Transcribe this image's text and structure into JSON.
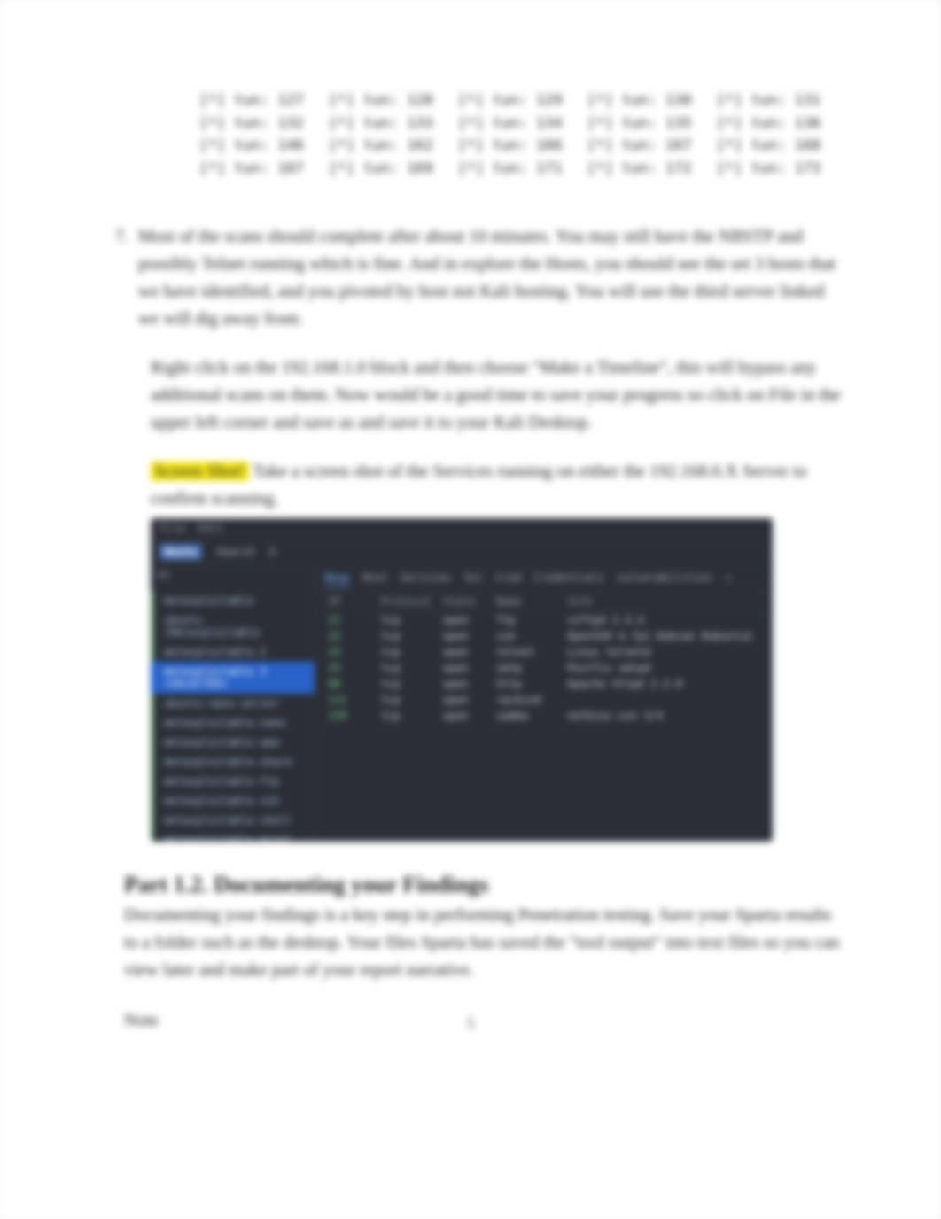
{
  "code_rows": [
    [
      "[*] tun: 127",
      "[*] tun: 128",
      "[*] tun: 129",
      "[*] tun: 130",
      "[*] tun: 131"
    ],
    [
      "[*] tun: 132",
      "[*] tun: 133",
      "[*] tun: 134",
      "[*] tun: 135",
      "[*] tun: 136"
    ],
    [
      "[*] tun: 146",
      "[*] tun: 162",
      "[*] tun: 166",
      "[*] tun: 167",
      "[*] tun: 168"
    ],
    [
      "[*] tun: 167",
      "[*] tun: 169",
      "[*] tun: 171",
      "[*] tun: 172",
      "[*] tun: 173"
    ]
  ],
  "step_number": "7",
  "step_text": "Most of the scans should complete after about 10 minutes. You may still have the NBSTP and possibly Telnet running which is fine. And in explore the Hosts, you should see the set 3 hosts that we have identified, and you pivoted by host not Kali hosting. You will use the third server linked we will dig away from.",
  "para_below": "Right click on the 192.168.1.0 block and then choose \"Make a Timeline\", this will bypass any additional scans on them. Now would be a good time to save your progress so click on File in the upper left corner and save as and save it to your Kali Desktop.",
  "highlight_label": "Screen Shot!",
  "highlight_rest": "Take a screen shot of the Services running on either the 192.168.0.X Server to confirm scanning.",
  "terminal": {
    "top": [
      "File",
      "Edit"
    ],
    "row2": {
      "hosts": "Hosts",
      "search": "Search",
      "x": "X"
    },
    "tabs": [
      "Nmap",
      "Host",
      "Services",
      "Vul",
      "Cred",
      "Credentials",
      "vulnerabilities",
      "+"
    ],
    "side_header": "OS",
    "hosts": [
      "metasploitable",
      "ubuntu (Metasploitable",
      "metasploitable-2",
      "metasploitable 3 (SELECTED)",
      "ubuntu-nano-server",
      "metasploitable-nano",
      "metasploitable-www",
      "metasploitable-share",
      "metasploitable-ftp",
      "metasploitable-ssh",
      "metasploitable-shell",
      "metasploitable-mysql"
    ],
    "cols": [
      "IP",
      "Protocol",
      "State",
      "Name",
      "Info"
    ],
    "rows": [
      {
        "port": "21",
        "proto": "tcp",
        "state": "open",
        "name": "ftp",
        "info": "vsftpd 2.3.4"
      },
      {
        "port": "22",
        "proto": "tcp",
        "state": "open",
        "name": "ssh",
        "info": "OpenSSH 4.7p1 Debian 8ubuntu1"
      },
      {
        "port": "23",
        "proto": "tcp",
        "state": "open",
        "name": "telnet",
        "info": "Linux telnetd"
      },
      {
        "port": "25",
        "proto": "tcp",
        "state": "open",
        "name": "smtp",
        "info": "Postfix smtpd"
      },
      {
        "port": "80",
        "proto": "tcp",
        "state": "open",
        "name": "http",
        "info": "Apache httpd 2.2.8"
      },
      {
        "port": "111",
        "proto": "tcp",
        "state": "open",
        "name": "rpcbind",
        "info": ""
      },
      {
        "port": "139",
        "proto": "tcp",
        "state": "open",
        "name": "samba",
        "info": "netbios-ssn 3/4"
      }
    ]
  },
  "part_heading": "Part 1.2. Documenting your Findings",
  "part_desc": "Documenting your findings is a key step in performing Penetration testing. Save your Sparta results to a folder such as the desktop. Your files Sparta has saved the \"tool output\" into text files so you can view later and make part of your report narrative.",
  "note_text": "Note",
  "page_number": "5"
}
